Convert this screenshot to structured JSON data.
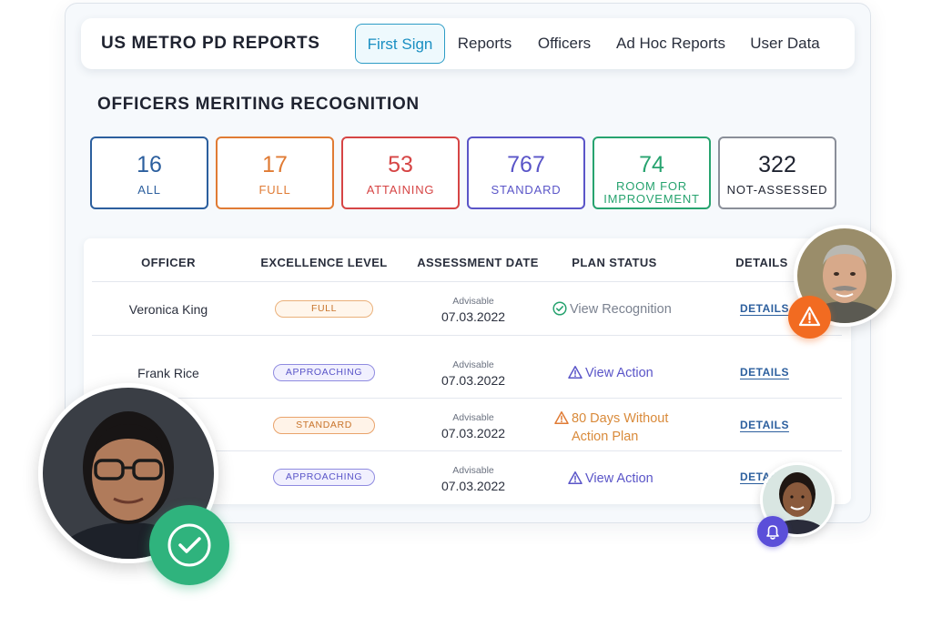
{
  "header": {
    "brand": "US METRO PD REPORTS",
    "tabs": [
      {
        "label": "First Sign",
        "active": true
      },
      {
        "label": "Reports",
        "active": false
      },
      {
        "label": "Officers",
        "active": false
      },
      {
        "label": "Ad Hoc Reports",
        "active": false
      },
      {
        "label": "User Data",
        "active": false
      }
    ]
  },
  "section": {
    "title": "OFFICERS MERITING RECOGNITION"
  },
  "stats": [
    {
      "value": "16",
      "label": "ALL",
      "color": "#2c5f9e"
    },
    {
      "value": "17",
      "label": "FULL",
      "color": "#e07b34"
    },
    {
      "value": "53",
      "label": "ATTAINING",
      "color": "#d64545"
    },
    {
      "value": "767",
      "label": "STANDARD",
      "color": "#5a55c8"
    },
    {
      "value": "74",
      "label_line1": "ROOM FOR",
      "label_line2": "IMPROVEMENT",
      "color": "#27a36f"
    },
    {
      "value": "322",
      "label": "NOT-ASSESSED",
      "color": "#2a2f3d"
    }
  ],
  "table": {
    "headers": [
      "OFFICER",
      "EXCELLENCE LEVEL",
      "ASSESSMENT DATE",
      "PLAN STATUS",
      "DETAILS"
    ],
    "rows": [
      {
        "officer": "Veronica King",
        "level": "FULL",
        "date_note": "Advisable",
        "date": "07.03.2022",
        "plan": "View Recognition",
        "details": "DETAILS"
      },
      {
        "officer": "Frank Rice",
        "level": "APPROACHING",
        "date_note": "Advisable",
        "date": "07.03.2022",
        "plan": "View Action",
        "details": "DETAILS"
      },
      {
        "officer": "",
        "level": "STANDARD",
        "date_note": "Advisable",
        "date": "07.03.2022",
        "plan_line1": "80 Days Without",
        "plan_line2": "Action Plan",
        "details": "DETAILS"
      },
      {
        "officer": "",
        "level": "APPROACHING",
        "date_note": "Advisable",
        "date": "07.03.2022",
        "plan": "View Action",
        "details": "DETAILS"
      }
    ]
  },
  "icons": {
    "check": "check-circle-icon",
    "warning": "warning-triangle-icon",
    "bell": "bell-icon",
    "approved": "checkmark-badge-icon"
  },
  "colors": {
    "accent": "#2d9cc6",
    "warning_badge": "#f26b21",
    "success_badge": "#2fb37d",
    "bell_badge": "#5b4fd9"
  }
}
